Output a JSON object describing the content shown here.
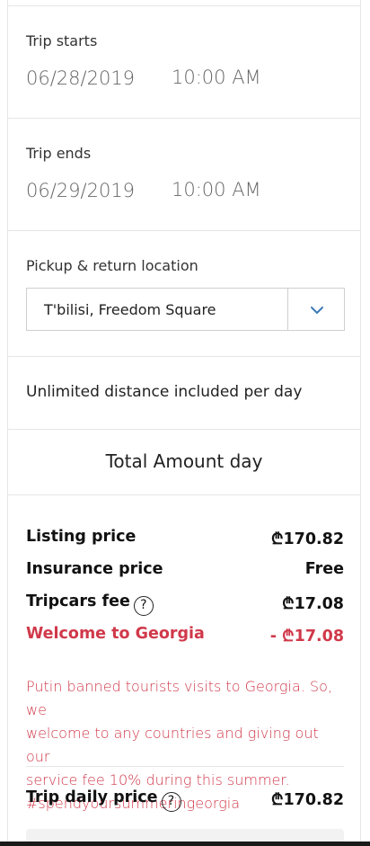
{
  "trip_start": {
    "label": "Trip starts",
    "date": "06/28/2019",
    "time": "10:00 AM"
  },
  "trip_end": {
    "label": "Trip ends",
    "date": "06/29/2019",
    "time": "10:00 AM"
  },
  "location": {
    "label": "Pickup & return location",
    "selected": "T'bilisi, Freedom Square",
    "icon": "chevron-down-icon",
    "accent": "#3d7ab8"
  },
  "distance_note": "Unlimited distance included per day",
  "total": {
    "title": "Total Amount day",
    "listing": {
      "label": "Listing price",
      "value": "₾170.82"
    },
    "insurance": {
      "label": "Insurance price",
      "value": "Free"
    },
    "fee": {
      "label": "Tripcars fee",
      "value": "₾17.08",
      "help": "?"
    },
    "promo": {
      "label": "Welcome to Georgia",
      "value": "- ₾17.08",
      "color": "#d0394a"
    },
    "promo_text_lines": [
      "Putin banned tourists visits to Georgia. So, we",
      "welcome to any countries and giving out our",
      "service fee 10% during this summer.",
      "#spendyoursummeringeorgia"
    ],
    "daily": {
      "label": "Trip daily price",
      "value": "₾170.82",
      "help": "?"
    }
  }
}
